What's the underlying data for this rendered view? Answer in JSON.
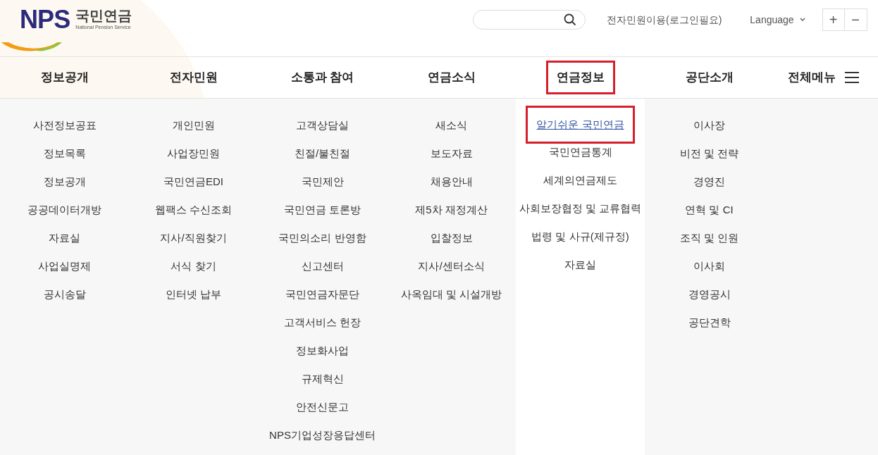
{
  "logo": {
    "mark": "NPS",
    "name": "국민연금",
    "subtitle": "National Pension Service"
  },
  "header": {
    "login_link": "전자민원이용(로그인필요)",
    "language": "Language",
    "zoom_in": "+",
    "zoom_out": "−"
  },
  "nav": [
    {
      "label": "정보공개",
      "selected": false,
      "items": [
        {
          "label": "사전정보공표",
          "selected": false
        },
        {
          "label": "정보목록",
          "selected": false
        },
        {
          "label": "정보공개",
          "selected": false
        },
        {
          "label": "공공데이터개방",
          "selected": false
        },
        {
          "label": "자료실",
          "selected": false
        },
        {
          "label": "사업실명제",
          "selected": false
        },
        {
          "label": "공시송달",
          "selected": false
        }
      ]
    },
    {
      "label": "전자민원",
      "selected": false,
      "items": [
        {
          "label": "개인민원",
          "selected": false
        },
        {
          "label": "사업장민원",
          "selected": false
        },
        {
          "label": "국민연금EDI",
          "selected": false
        },
        {
          "label": "웹팩스 수신조회",
          "selected": false
        },
        {
          "label": "지사/직원찾기",
          "selected": false
        },
        {
          "label": "서식 찾기",
          "selected": false
        },
        {
          "label": "인터넷 납부",
          "selected": false
        }
      ]
    },
    {
      "label": "소통과 참여",
      "selected": false,
      "items": [
        {
          "label": "고객상담실",
          "selected": false
        },
        {
          "label": "친절/불친절",
          "selected": false
        },
        {
          "label": "국민제안",
          "selected": false
        },
        {
          "label": "국민연금 토론방",
          "selected": false
        },
        {
          "label": "국민의소리 반영함",
          "selected": false
        },
        {
          "label": "신고센터",
          "selected": false
        },
        {
          "label": "국민연금자문단",
          "selected": false
        },
        {
          "label": "고객서비스 헌장",
          "selected": false
        },
        {
          "label": "정보화사업",
          "selected": false
        },
        {
          "label": "규제혁신",
          "selected": false
        },
        {
          "label": "안전신문고",
          "selected": false
        },
        {
          "label": "NPS기업성장응답센터",
          "selected": false
        }
      ]
    },
    {
      "label": "연금소식",
      "selected": false,
      "items": [
        {
          "label": "새소식",
          "selected": false
        },
        {
          "label": "보도자료",
          "selected": false
        },
        {
          "label": "채용안내",
          "selected": false
        },
        {
          "label": "제5차 재정계산",
          "selected": false
        },
        {
          "label": "입찰정보",
          "selected": false
        },
        {
          "label": "지사/센터소식",
          "selected": false
        },
        {
          "label": "사옥임대 및 시설개방",
          "selected": false
        }
      ]
    },
    {
      "label": "연금정보",
      "selected": true,
      "items": [
        {
          "label": "알기쉬운 국민연금",
          "selected": true
        },
        {
          "label": "국민연금통계",
          "selected": false
        },
        {
          "label": "세계의연금제도",
          "selected": false
        },
        {
          "label": "사회보장협정 및 교류협력",
          "selected": false
        },
        {
          "label": "법령 및 사규(제규정)",
          "selected": false
        },
        {
          "label": "자료실",
          "selected": false
        }
      ]
    },
    {
      "label": "공단소개",
      "selected": false,
      "items": [
        {
          "label": "이사장",
          "selected": false
        },
        {
          "label": "비전 및 전략",
          "selected": false
        },
        {
          "label": "경영진",
          "selected": false
        },
        {
          "label": "연혁 및 CI",
          "selected": false
        },
        {
          "label": "조직 및 인원",
          "selected": false
        },
        {
          "label": "이사회",
          "selected": false
        },
        {
          "label": "경영공시",
          "selected": false
        },
        {
          "label": "공단견학",
          "selected": false
        }
      ]
    }
  ],
  "all_menu": "전체메뉴"
}
